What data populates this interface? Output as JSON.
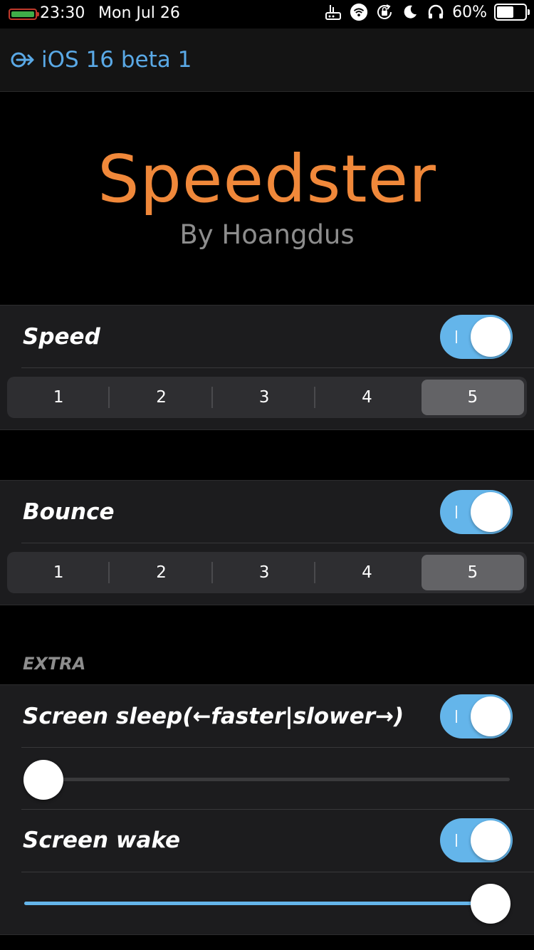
{
  "status_bar": {
    "time": "23:30",
    "date": "Mon Jul 26",
    "battery_percent": "60%",
    "icons": [
      "battery-left-icon",
      "router-icon",
      "wifi-icon",
      "rotation-lock-icon",
      "moon-icon",
      "headphones-icon",
      "battery-icon"
    ]
  },
  "nav": {
    "back_label": "iOS 16 beta 1",
    "accent_color": "#5aa9e6"
  },
  "header": {
    "title": "Speedster",
    "subtitle": "By Hoangdus",
    "title_color": "#f0883a"
  },
  "speed": {
    "label": "Speed",
    "enabled": true,
    "segments": [
      "1",
      "2",
      "3",
      "4",
      "5"
    ],
    "selected_index": 4
  },
  "bounce": {
    "label": "Bounce",
    "enabled": true,
    "segments": [
      "1",
      "2",
      "3",
      "4",
      "5"
    ],
    "selected_index": 4
  },
  "extra": {
    "header": "EXTRA",
    "screen_sleep": {
      "label": "Screen sleep(←faster|slower→)",
      "enabled": true,
      "slider_value": 0.0
    },
    "screen_wake": {
      "label": "Screen wake",
      "enabled": true,
      "slider_value": 1.0
    }
  }
}
